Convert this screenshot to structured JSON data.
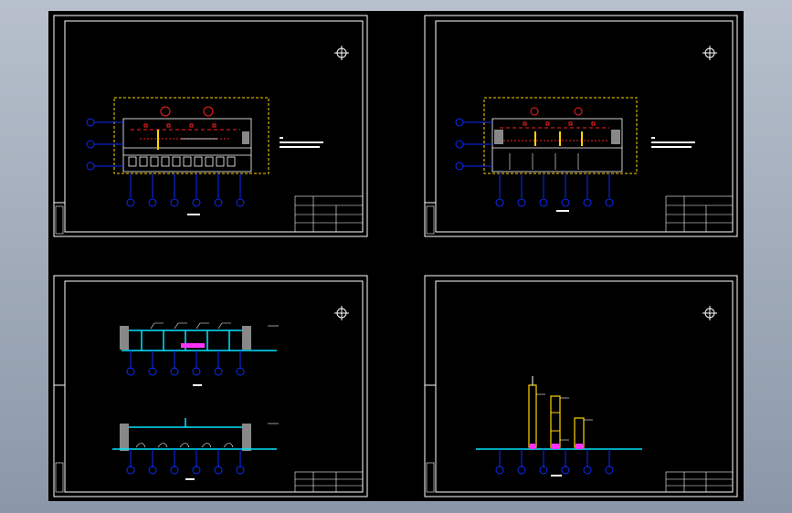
{
  "viewer": {
    "background": "#000000",
    "frame_color": "#ffffff",
    "pipe_color": "#00e5ff",
    "axis_color": "#0a2cff",
    "red": "#ff2020",
    "yellow": "#ffd400",
    "magenta": "#ff33ff"
  },
  "sheets": [
    {
      "name": "sheet-top-left",
      "kind": "plan"
    },
    {
      "name": "sheet-top-right",
      "kind": "plan"
    },
    {
      "name": "sheet-bottom-left",
      "kind": "section-elevations"
    },
    {
      "name": "sheet-bottom-right",
      "kind": "riser-diagram"
    }
  ]
}
